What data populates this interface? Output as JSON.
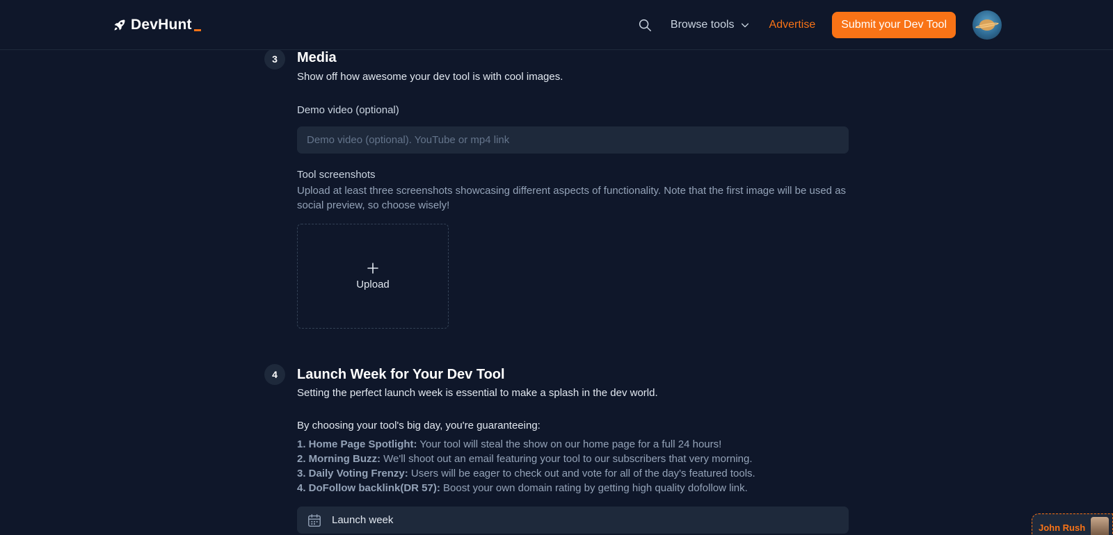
{
  "header": {
    "logo_text": "DevHunt",
    "nav": {
      "browse_label": "Browse tools",
      "advertise_label": "Advertise",
      "submit_label": "Submit your Dev Tool"
    },
    "icons": [
      "rocket-icon",
      "search-icon",
      "chevron-down-icon",
      "avatar"
    ]
  },
  "media": {
    "step": "3",
    "title": "Media",
    "description": "Show off how awesome your dev tool is with cool images.",
    "demo_video_label": "Demo video (optional)",
    "demo_video_placeholder": "Demo video (optional). YouTube or mp4 link",
    "demo_video_value": "",
    "screenshots_label": "Tool screenshots",
    "screenshots_help": "Upload at least three screenshots showcasing different aspects of functionality. Note that the first image will be used as social preview, so choose wisely!",
    "upload_label": "Upload"
  },
  "launch": {
    "step": "4",
    "title": "Launch Week for Your Dev Tool",
    "description": "Setting the perfect launch week is essential to make a splash in the dev world.",
    "lead": "By choosing your tool's big day, you're guaranteeing:",
    "benefits": [
      {
        "title": "1. Home Page Spotlight:",
        "text": "Your tool will steal the show on our home page for a full 24 hours!"
      },
      {
        "title": "2. Morning Buzz:",
        "text": "We'll shoot out an email featuring your tool to our subscribers that very morning."
      },
      {
        "title": "3. Daily Voting Frenzy:",
        "text": "Users will be eager to check out and vote for all of the day's featured tools."
      },
      {
        "title": "4. DoFollow backlink(DR 57):",
        "text": "Boost your own domain rating by getting high quality dofollow link."
      }
    ],
    "launch_week_label": "Launch week"
  },
  "chat_widget": {
    "name": "John Rush"
  },
  "colors": {
    "background": "#0f172a",
    "surface": "#1e293b",
    "accent": "#f97316",
    "muted_text": "#94a3b8"
  }
}
